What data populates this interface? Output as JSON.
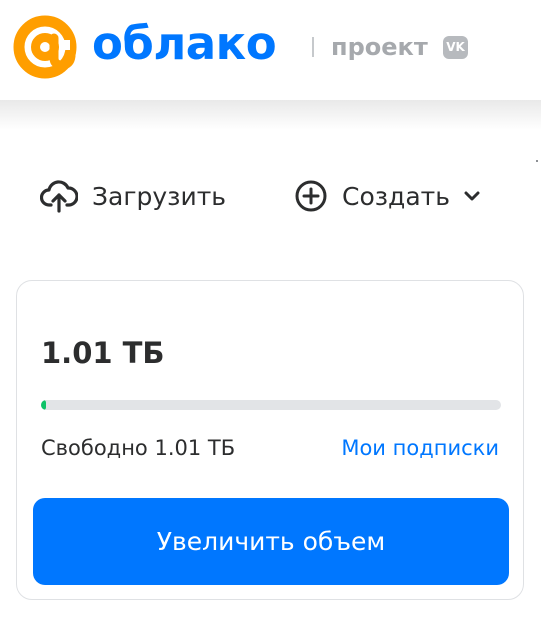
{
  "header": {
    "logo_text": "облако",
    "project_text": "проект",
    "vk_badge": "VK"
  },
  "actions": {
    "upload_label": "Загрузить",
    "create_label": "Создать"
  },
  "storage": {
    "total": "1.01 ТБ",
    "free_text": "Свободно 1.01 ТБ",
    "used_fraction": 0.01,
    "subscriptions_link": "Мои подписки",
    "increase_button": "Увеличить объем"
  },
  "colors": {
    "brand_blue": "#0077ff",
    "logo_orange": "#ff9e00",
    "progress_green": "#0dc268"
  },
  "icons": {
    "upload": "cloud-upload-icon",
    "create": "plus-circle-icon",
    "dropdown": "chevron-down-icon"
  }
}
